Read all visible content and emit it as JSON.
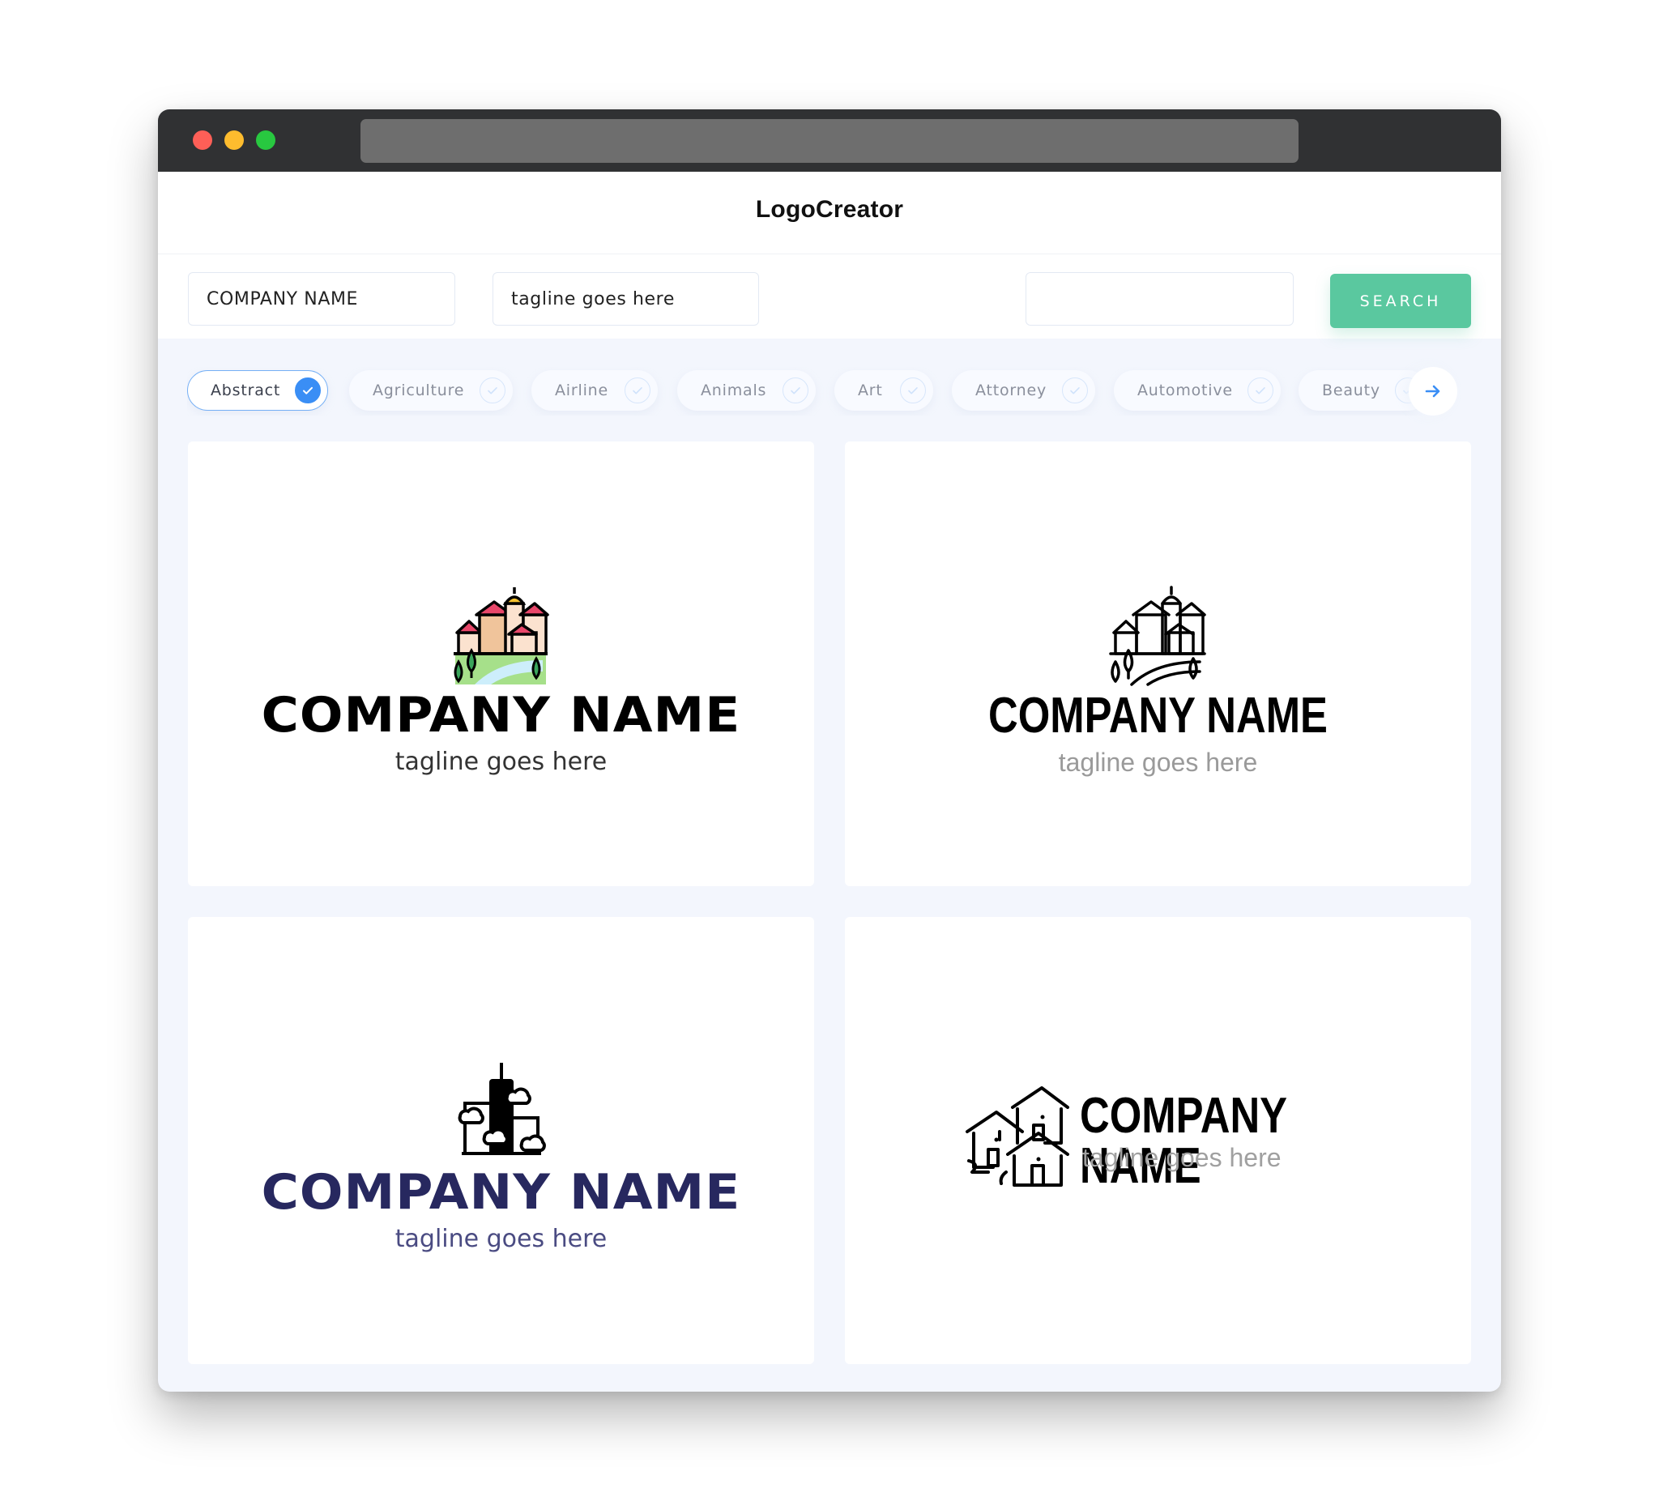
{
  "app": {
    "title": "LogoCreator"
  },
  "window_controls": [
    "close",
    "minimize",
    "maximize"
  ],
  "search": {
    "company_name_value": "COMPANY NAME",
    "tagline_value": "tagline goes here",
    "keyword_value": "",
    "button_label": "SEARCH"
  },
  "filters": {
    "categories": [
      {
        "label": "Abstract",
        "selected": true
      },
      {
        "label": "Agriculture",
        "selected": false
      },
      {
        "label": "Airline",
        "selected": false
      },
      {
        "label": "Animals",
        "selected": false
      },
      {
        "label": "Art",
        "selected": false
      },
      {
        "label": "Attorney",
        "selected": false
      },
      {
        "label": "Automotive",
        "selected": false
      },
      {
        "label": "Beauty",
        "selected": false
      }
    ],
    "next_icon": "arrow-right-icon"
  },
  "logos": [
    {
      "company": "COMPANY NAME",
      "tagline": "tagline goes here",
      "icon": "village-colored-icon",
      "name_color": "#000000",
      "tagline_color": "#333333"
    },
    {
      "company": "COMPANY NAME",
      "tagline": "tagline goes here",
      "icon": "village-outline-icon",
      "name_color": "#000000",
      "tagline_color": "#9a9a9a"
    },
    {
      "company": "COMPANY NAME",
      "tagline": "tagline goes here",
      "icon": "skyscraper-clouds-icon",
      "name_color": "#27285f",
      "tagline_color": "#4a4b82"
    },
    {
      "company": "COMPANY NAME",
      "tagline": "tagline goes here",
      "icon": "houses-outline-icon",
      "name_color": "#000000",
      "tagline_color": "#a0a0a0"
    }
  ],
  "colors": {
    "accent": "#3a8ef5",
    "search_button": "#5ac89f",
    "titlebar": "#303133",
    "page_bg": "#f3f6fd"
  }
}
